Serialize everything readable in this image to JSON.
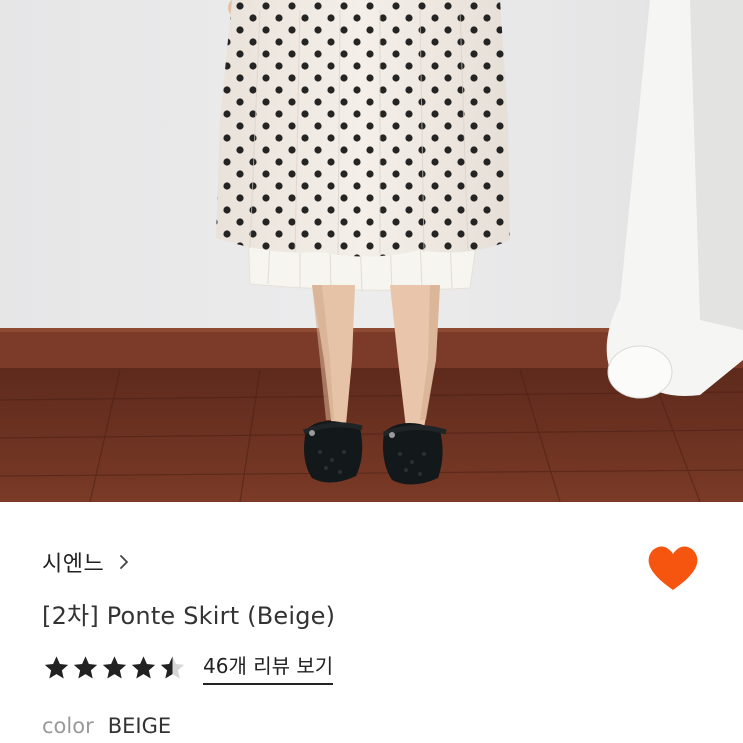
{
  "product_image": {
    "alt": "",
    "colors": {
      "wall": "#e9e9ea",
      "floor": "#6b3220",
      "baseboard": "#7a3a28",
      "skirt": "#f1ece6",
      "dots": "#1a1a1a",
      "lace": "#f7f5f0",
      "legs": "#e7c3a8",
      "shoes": "#14181a"
    }
  },
  "brand": {
    "name": "시엔느",
    "chevron_icon": "chevron-right-icon"
  },
  "wishlist": {
    "icon": "heart-icon",
    "active": true,
    "color": "#f5550f"
  },
  "product": {
    "title": "[2차] Ponte Skirt (Beige)"
  },
  "rating": {
    "value": 4.5,
    "max": 5,
    "star_color": "#222222",
    "reviews_link": "46개 리뷰 보기"
  },
  "color": {
    "label": "color",
    "value": "BEIGE"
  }
}
